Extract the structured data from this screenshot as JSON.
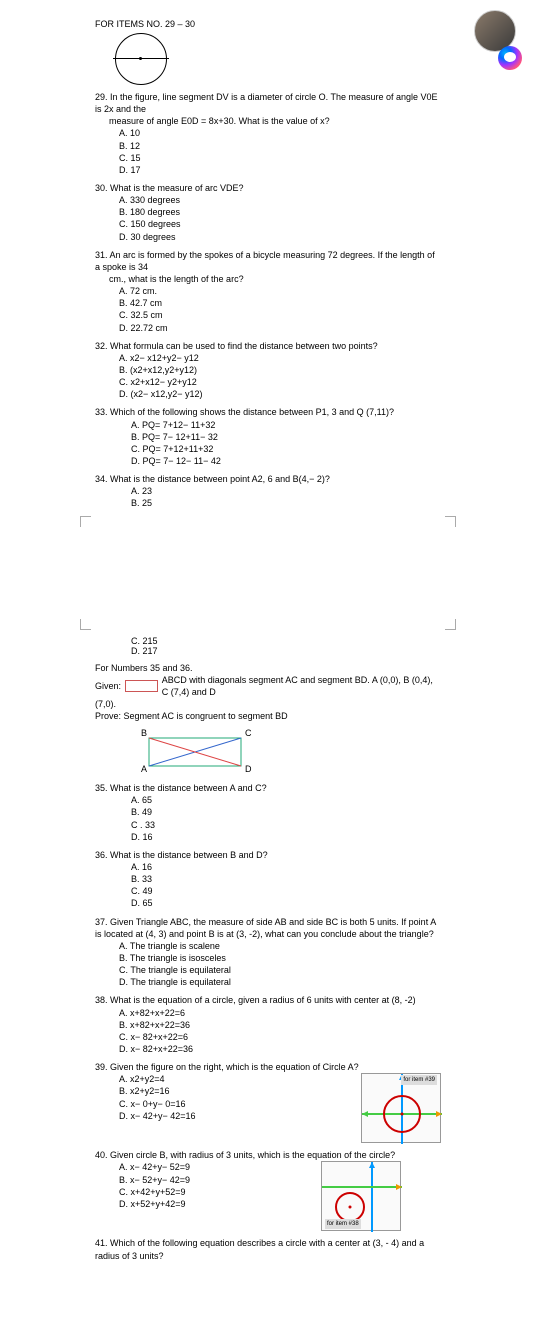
{
  "header": {
    "forItems": "FOR ITEMS NO. 29 – 30"
  },
  "q29": {
    "text": "29.       In the figure, line segment DV is a diameter of circle O.  The measure of angle V0E is 2x and the",
    "text2": "measure of angle E0D = 8x+30.  What is the value of x?",
    "a": "A.   10",
    "b": "B.   12",
    "c": "C.   15",
    "d": "D.   17"
  },
  "q30": {
    "text": "30.       What is the measure of arc VDE?",
    "a": "A.   330 degrees",
    "b": "B.   180 degrees",
    "c": "C.   150 degrees",
    "d": "D.   30 degrees"
  },
  "q31": {
    "text": "31.       An arc is formed by the spokes of a bicycle measuring 72 degrees.  If the length of a spoke is 34",
    "text2": "cm., what is the length of the arc?",
    "a": "A.   72 cm.",
    "b": "B.   42.7 cm",
    "c": "C.   32.5 cm",
    "d": "D.   22.72 cm"
  },
  "q32": {
    "text": "32.       What formula can be used to find the distance between two points?",
    "a": "A.   x2− x12+y2− y12",
    "b": "B.   (x2+x12,y2+y12)",
    "c": "C.   x2+x12− y2+y12",
    "d": "D.   (x2− x12,y2− y12)"
  },
  "q33": {
    "text": "33. Which of the following shows the distance between P1, 3 and Q (7,11)?",
    "a": "A. PQ= 7+12−  11+32",
    "b": "B. PQ= 7− 12+11− 32",
    "c": "C. PQ= 7+12+11+32",
    "d": "D. PQ= 7− 12−  11− 42"
  },
  "q34": {
    "text": "34. What is the distance between point A2, 6 and B(4,− 2)?",
    "a": "A. 23",
    "b": "B. 25",
    "c": "C. 215",
    "d": "D. 217"
  },
  "section35": {
    "line1": "For Numbers 35 and 36.",
    "givenLabel": "Given:",
    "givenRest": "ABCD with diagonals segment AC and segment BD.  A (0,0), B (0,4), C (7,4) and D",
    "given2": "(7,0).",
    "prove": "Prove: Segment AC is congruent to segment BD",
    "vB": "B",
    "vC": "C",
    "vA": "A",
    "vD": "D"
  },
  "q35": {
    "text": "35. What is the distance between A and C?",
    "a": "A. 65",
    "b": "B. 49",
    "c": "C . 33",
    "d": "D. 16"
  },
  "q36": {
    "text": "36. What is the distance between B and D?",
    "a": "A. 16",
    "b": "B. 33",
    "c": "C. 49",
    "d": "D. 65"
  },
  "q37": {
    "text": "37. Given Triangle ABC, the measure of side AB and side BC is both 5 units.  If point A is located at (4, 3) and point B is at (3, -2), what can you conclude about the triangle?",
    "a": "A.   The triangle is scalene",
    "b": "B.   The triangle is isosceles",
    "c": "C.   The triangle is equilateral",
    "d": "D.   The triangle is equilateral"
  },
  "q38": {
    "text": "38. What is the equation of a circle, given a radius of 6 units with center at (8, -2)",
    "a": "A.   x+82+x+22=6",
    "b": "B.   x+82+x+22=36",
    "c": "C.   x− 82+x+22=6",
    "d": "D.   x− 82+x+22=36"
  },
  "q39": {
    "text": "39. Given the figure on the right, which is the equation of Circle A?",
    "a": "A.   x2+y2=4",
    "b": "B.   x2+y2=16",
    "c": "C.   x− 0+y− 0=16",
    "d": "D.   x− 42+y− 42=16",
    "plotLabel": "for item #39"
  },
  "q40": {
    "text": "40. Given circle B, with radius of 3 units, which is the equation of the circle?",
    "a": "A.   x− 42+y− 52=9",
    "b": "B.   x− 52+y− 42=9",
    "c": "C.   x+42+y+52=9",
    "d": "D.   x+52+y+42=9",
    "plotLabel": "for item #38"
  },
  "q41": {
    "text": "41. Which of the following equation describes a circle with a center at (3, - 4) and a radius of 3 units?"
  },
  "chart_data": {
    "type": "diagram",
    "rectangle_ABCD": {
      "A": [
        0,
        0
      ],
      "B": [
        0,
        4
      ],
      "C": [
        7,
        4
      ],
      "D": [
        7,
        0
      ]
    },
    "circle39": {
      "center": [
        0,
        0
      ],
      "radius": 4
    },
    "circle40": {
      "center": [
        -5,
        -4
      ],
      "radius": 3,
      "note": "approx from figure"
    }
  }
}
